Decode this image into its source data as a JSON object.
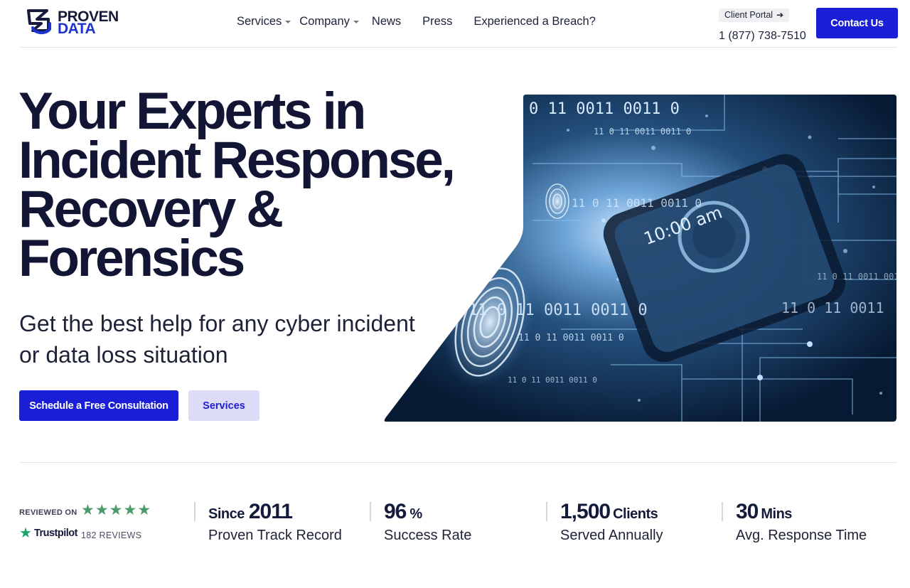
{
  "brand": {
    "line1": "PROVEN",
    "line2": "DATA",
    "colors": {
      "dark": "#161b3c",
      "accent": "#1f33d1"
    }
  },
  "nav": {
    "items": [
      {
        "label": "Services",
        "has_dropdown": true
      },
      {
        "label": "Company",
        "has_dropdown": true
      },
      {
        "label": "News",
        "has_dropdown": false
      },
      {
        "label": "Press",
        "has_dropdown": false
      },
      {
        "label": "Experienced a Breach?",
        "has_dropdown": false
      }
    ]
  },
  "header": {
    "client_portal_label": "Client Portal",
    "client_portal_icon": "arrow-right-icon",
    "phone": "1 (877) 738-7510",
    "contact_label": "Contact Us"
  },
  "hero": {
    "title_lines": [
      "Your Experts in",
      "Incident Response,",
      "Recovery &",
      "Forensics"
    ],
    "subtitle": "Get the best help for any cyber incident or data loss situation",
    "primary_cta": "Schedule a Free Consultation",
    "secondary_cta": "Services",
    "image": {
      "subject": "fingerprint-and-smartphone-over-binary-circuit",
      "binary_texts": [
        "0 11 0011 0011 0",
        "11 0 11 0011 0011 0",
        "11 0 11 0011 0011 0",
        "11 0 11 0011 0011 0",
        "11 0 11 0011 0011 0",
        "10:00 am",
        "11 0 11 0011"
      ]
    }
  },
  "social_proof": {
    "reviewed_on": "REVIEWED ON",
    "stars": 5,
    "platform": "Trustpilot",
    "reviews": "182 REVIEWS"
  },
  "stats": [
    {
      "prefix": "Since",
      "value": "2011",
      "suffix": "",
      "label": "Proven Track Record"
    },
    {
      "prefix": "",
      "value": "96",
      "suffix": "%",
      "label": "Success Rate"
    },
    {
      "prefix": "",
      "value": "1,500",
      "suffix": "Clients",
      "label": "Served Annually"
    },
    {
      "prefix": "",
      "value": "30",
      "suffix": "Mins",
      "label": "Avg. Response Time"
    }
  ],
  "colors": {
    "primary_button": "#1a1fd6",
    "secondary_button_bg": "#dcdcf6",
    "text_dark": "#121634",
    "trustpilot_green": "#1ea36b"
  }
}
